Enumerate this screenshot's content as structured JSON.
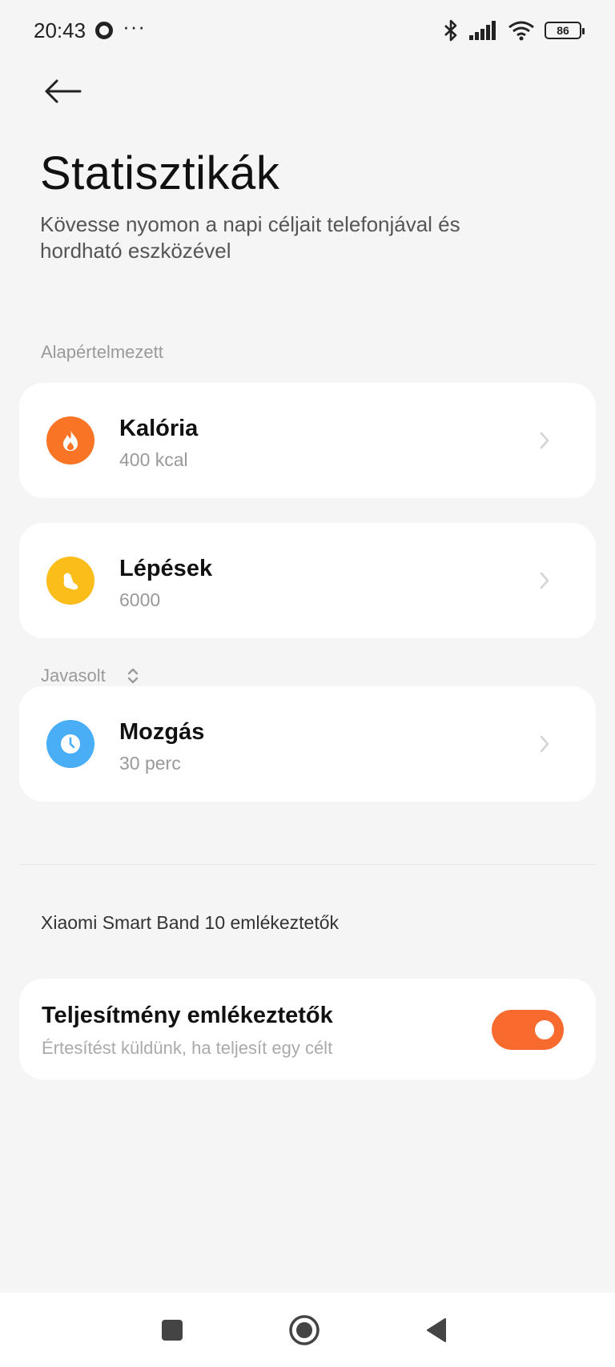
{
  "status_bar": {
    "time": "20:43",
    "dots": "···",
    "battery": "86",
    "icons": [
      "bluetooth-icon",
      "signal-icon",
      "wifi-icon",
      "battery-icon"
    ]
  },
  "header": {
    "back_icon": "arrow-left-icon",
    "title": "Statisztikák",
    "subtitle": "Kövesse nyomon a napi céljait telefonjával és hordható eszközével"
  },
  "sections": {
    "default_label": "Alapértelmezett",
    "suggested_label": "Javasolt"
  },
  "goals": [
    {
      "title": "Kalória",
      "value": "400 kcal",
      "icon": "flame-icon",
      "color": "#f97424"
    },
    {
      "title": "Lépések",
      "value": "6000",
      "icon": "footprint-icon",
      "color": "#fbbd1a"
    },
    {
      "title": "Mozgás",
      "value": "30 perc",
      "icon": "clock-icon",
      "color": "#4aaef7"
    }
  ],
  "band": {
    "header": "Xiaomi Smart Band 10 emlékeztetők",
    "toggle_title": "Teljesítmény emlékeztetők",
    "toggle_desc": "Értesítést küldünk, ha teljesít egy célt",
    "toggle_on": true,
    "accent": "#f96a2e"
  },
  "navbar": {
    "icons": [
      "recents-square-icon",
      "home-circle-icon",
      "back-triangle-icon"
    ]
  }
}
